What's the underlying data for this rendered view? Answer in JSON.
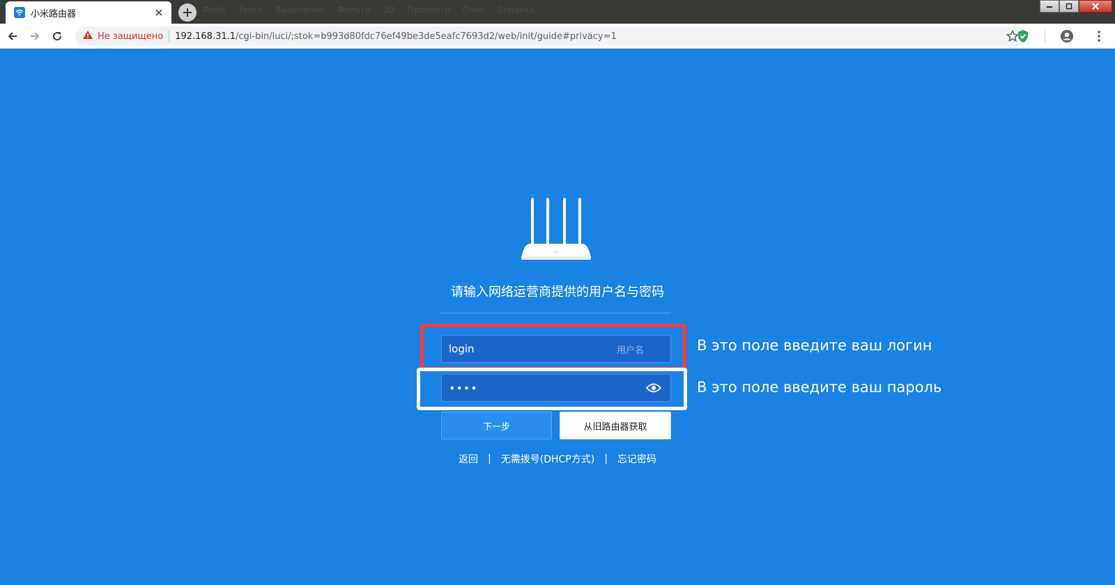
{
  "browser": {
    "tab": {
      "title": "小米路由器"
    },
    "background_menu": [
      "Файл",
      "Текст",
      "Выделение",
      "Фильтр",
      "3D",
      "Просмотр",
      "Окно",
      "Справка"
    ],
    "address_bar": {
      "security_label": "Не защищено",
      "url_host": "192.168.31.1",
      "url_path": "/cgi-bin/luci/;stok=b993d80fdc76ef49be3de5eafc7693d2/web/init/guide#privacy=1"
    }
  },
  "page": {
    "heading": "请输入网络运营商提供的用户名与密码",
    "username": {
      "value": "login",
      "placeholder": "用户名"
    },
    "password": {
      "masked_value": "••••"
    },
    "buttons": {
      "next": "下一步",
      "from_old_router": "从旧路由器获取"
    },
    "links": {
      "back": "返回",
      "no_dial": "无需拨号(DHCP方式)",
      "forgot": "忘记密码",
      "separator": "|"
    },
    "annotations": {
      "login_hint": "В это поле введите ваш логин",
      "password_hint": "В это поле введите ваш пароль"
    },
    "router_label": "mi"
  },
  "colors": {
    "page_background": "#1a82e2",
    "field_background": "#1c65c8",
    "primary_button": "#2a8ef0",
    "highlight_red": "#ff3b3b",
    "highlight_white": "#ffffff",
    "insecure_red": "#d93025"
  }
}
